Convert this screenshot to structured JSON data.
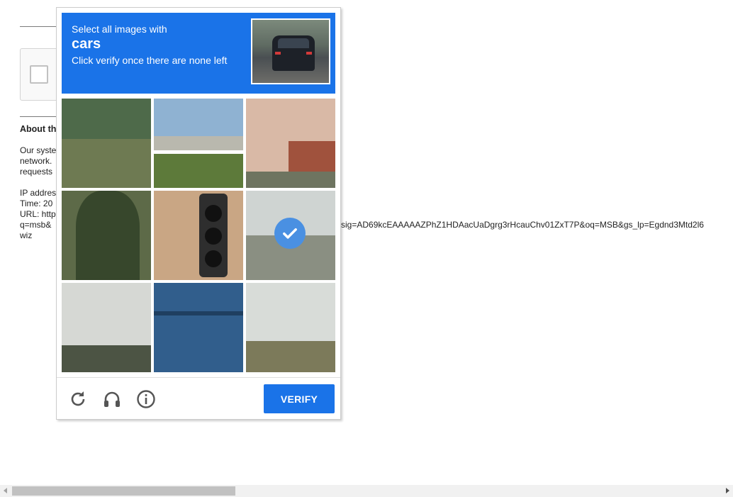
{
  "background": {
    "about_title": "About th",
    "paragraph": [
      "Our syste",
      "network.",
      "requests"
    ],
    "info": [
      "IP addres",
      "Time: 20",
      "URL: http",
      "q=msb&",
      "wiz"
    ],
    "url_tail": "sig=AD69kcEAAAAAZPhZ1HDAacUaDgrg3rHcauChv01ZxT7P&oq=MSB&gs_lp=Egdnd3Mtd2l6"
  },
  "challenge": {
    "prompt_line1": "Select all images with",
    "target": "cars",
    "prompt_line3": "Click verify once there are none left",
    "tiles": [
      {
        "name": "tile-1-grass-wall",
        "selected": false
      },
      {
        "name": "tile-2-overpass",
        "selected": false
      },
      {
        "name": "tile-3-stairs",
        "selected": false
      },
      {
        "name": "tile-4-palm-tree",
        "selected": false
      },
      {
        "name": "tile-5-traffic-light",
        "selected": false
      },
      {
        "name": "tile-6-road",
        "selected": true
      },
      {
        "name": "tile-7-hill",
        "selected": false
      },
      {
        "name": "tile-8-blue-gate",
        "selected": false
      },
      {
        "name": "tile-9-trees",
        "selected": false
      }
    ],
    "verify_label": "VERIFY",
    "icons": [
      "reload-icon",
      "audio-icon",
      "info-icon"
    ]
  },
  "colors": {
    "accent": "#1a73e8",
    "check": "#4a90e2"
  }
}
